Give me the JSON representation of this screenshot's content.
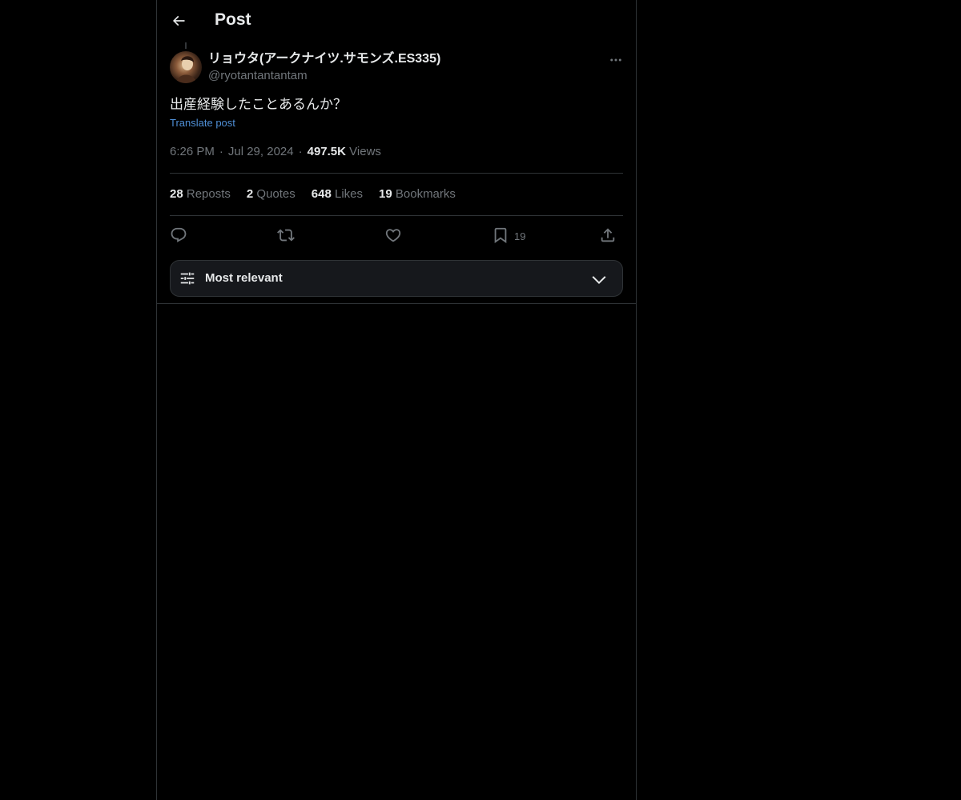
{
  "header": {
    "title": "Post",
    "back_icon": "arrow-left-icon"
  },
  "post": {
    "author": {
      "display_name": "リョウタ(アークナイツ.サモンズ.ES335)",
      "handle": "@ryotantantantam",
      "avatar_icon": "avatar"
    },
    "text": "出産経験したことあるんか？",
    "translate_label": "Translate post",
    "time": "6:26 PM",
    "date": "Jul 29, 2024",
    "views_count": "497.5K",
    "views_label": "Views"
  },
  "stats": {
    "reposts_count": "28",
    "reposts_label": "Reposts",
    "quotes_count": "2",
    "quotes_label": "Quotes",
    "likes_count": "648",
    "likes_label": "Likes",
    "bookmarks_count": "19",
    "bookmarks_label": "Bookmarks"
  },
  "actions": {
    "reply_icon": "reply-icon",
    "repost_icon": "repost-icon",
    "like_icon": "heart-icon",
    "bookmark_icon": "bookmark-icon",
    "bookmark_count": "19",
    "share_icon": "share-icon"
  },
  "sort": {
    "label": "Most relevant",
    "icon": "sliders-icon",
    "chevron": "chevron-down-icon"
  },
  "colors": {
    "background": "#000000",
    "text": "#e7e9ea",
    "muted": "#71767b",
    "border": "#2f3336",
    "link": "#4f8fd6"
  }
}
